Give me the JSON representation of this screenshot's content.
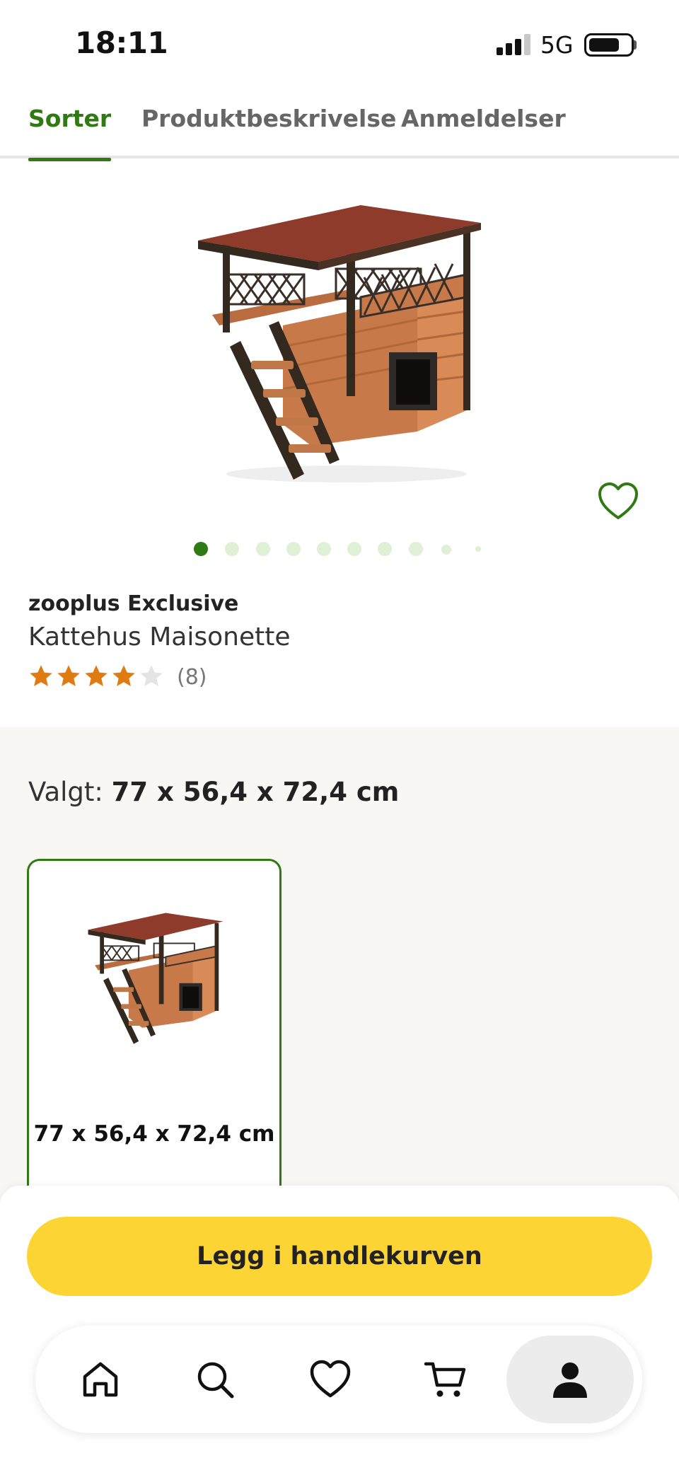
{
  "status_bar": {
    "time": "18:11",
    "network": "5G"
  },
  "tabs": [
    {
      "label": "Sorter",
      "active": true
    },
    {
      "label": "Produktbeskrivelse",
      "active": false
    },
    {
      "label": "Anmeldelser",
      "active": false
    }
  ],
  "gallery": {
    "image_count": 10,
    "current_index": 1
  },
  "product": {
    "brand": "zooplus Exclusive",
    "name": "Kattehus Maisonette",
    "rating": 4,
    "rating_max": 5,
    "review_count": "(8)"
  },
  "variant": {
    "selected_prefix": "Valgt: ",
    "selected_value": "77 x 56,4 x 72,4 cm",
    "options": [
      {
        "label": "77 x 56,4 x 72,4 cm",
        "selected": true
      }
    ]
  },
  "cta": {
    "add_to_cart": "Legg i handlekurven"
  },
  "bottom_nav": [
    {
      "icon": "home-icon",
      "active": false
    },
    {
      "icon": "search-icon",
      "active": false
    },
    {
      "icon": "heart-icon",
      "active": false
    },
    {
      "icon": "cart-icon",
      "active": false
    },
    {
      "icon": "user-icon",
      "active": true
    }
  ],
  "colors": {
    "brand_green": "#2f7a13",
    "cta_yellow": "#fcd535",
    "star_orange": "#e07b12",
    "variant_bg": "#f8f7f4"
  }
}
